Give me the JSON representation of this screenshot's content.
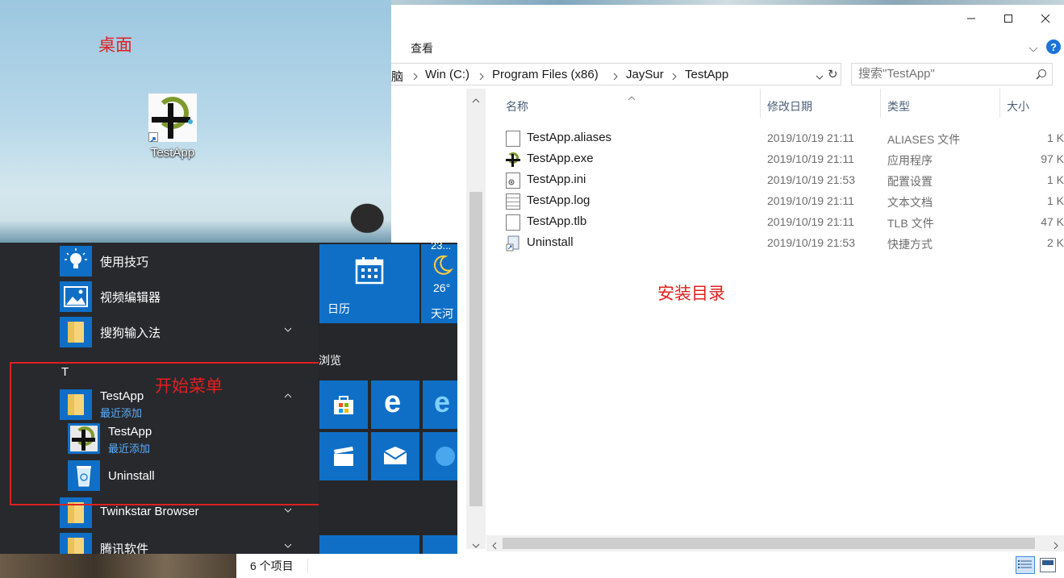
{
  "annotations": {
    "desktop": "桌面",
    "start_menu": "开始菜单",
    "install_dir": "安装目录"
  },
  "desktop": {
    "icon_label": "TestApp",
    "icon_name": "testapp-logo-icon"
  },
  "start_menu": {
    "items": [
      {
        "label": "使用技巧",
        "icon": "lightbulb-icon"
      },
      {
        "label": "视频编辑器",
        "icon": "photos-icon"
      },
      {
        "label": "搜狗输入法",
        "icon": "folder-icon",
        "expandable": true
      },
      {
        "label": "TestApp",
        "sub": "最近添加",
        "icon": "folder-icon",
        "expanded": true
      },
      {
        "label": "TestApp",
        "sub": "最近添加",
        "icon": "testapp-logo-icon"
      },
      {
        "label": "Uninstall",
        "icon": "recycle-bin-icon"
      },
      {
        "label": "Twinkstar Browser",
        "icon": "folder-icon",
        "expandable": true
      },
      {
        "label": "腾讯软件",
        "icon": "folder-icon",
        "expandable": true
      }
    ],
    "section_letter": "T",
    "tiles": {
      "calendar_label": "日历",
      "weather_temp": "26°",
      "weather_top": "23...",
      "weather_city": "天河",
      "group_label": "浏览"
    }
  },
  "explorer": {
    "ribbon_tab": "查看",
    "breadcrumb": [
      "脑",
      "Win (C:)",
      "Program Files (x86)",
      "JaySur",
      "TestApp"
    ],
    "search_placeholder": "搜索\"TestApp\"",
    "columns": {
      "name": "名称",
      "date": "修改日期",
      "type": "类型",
      "size": "大小"
    },
    "files": [
      {
        "name": "TestApp.aliases",
        "date": "2019/10/19 21:11",
        "type": "ALIASES 文件",
        "size": "1 K",
        "icon": "blank-file-icon"
      },
      {
        "name": "TestApp.exe",
        "date": "2019/10/19 21:11",
        "type": "应用程序",
        "size": "97 K",
        "icon": "testapp-logo-icon"
      },
      {
        "name": "TestApp.ini",
        "date": "2019/10/19 21:53",
        "type": "配置设置",
        "size": "1 K",
        "icon": "settings-file-icon"
      },
      {
        "name": "TestApp.log",
        "date": "2019/10/19 21:11",
        "type": "文本文档",
        "size": "1 K",
        "icon": "text-file-icon"
      },
      {
        "name": "TestApp.tlb",
        "date": "2019/10/19 21:11",
        "type": "TLB 文件",
        "size": "47 K",
        "icon": "blank-file-icon"
      },
      {
        "name": "Uninstall",
        "date": "2019/10/19 21:53",
        "type": "快捷方式",
        "size": "2 K",
        "icon": "shortcut-icon"
      }
    ],
    "status": "6 个项目"
  },
  "colors": {
    "annotation": "#e02020",
    "tile_blue": "#0f6fc6",
    "recent_added": "#5aaeff"
  }
}
